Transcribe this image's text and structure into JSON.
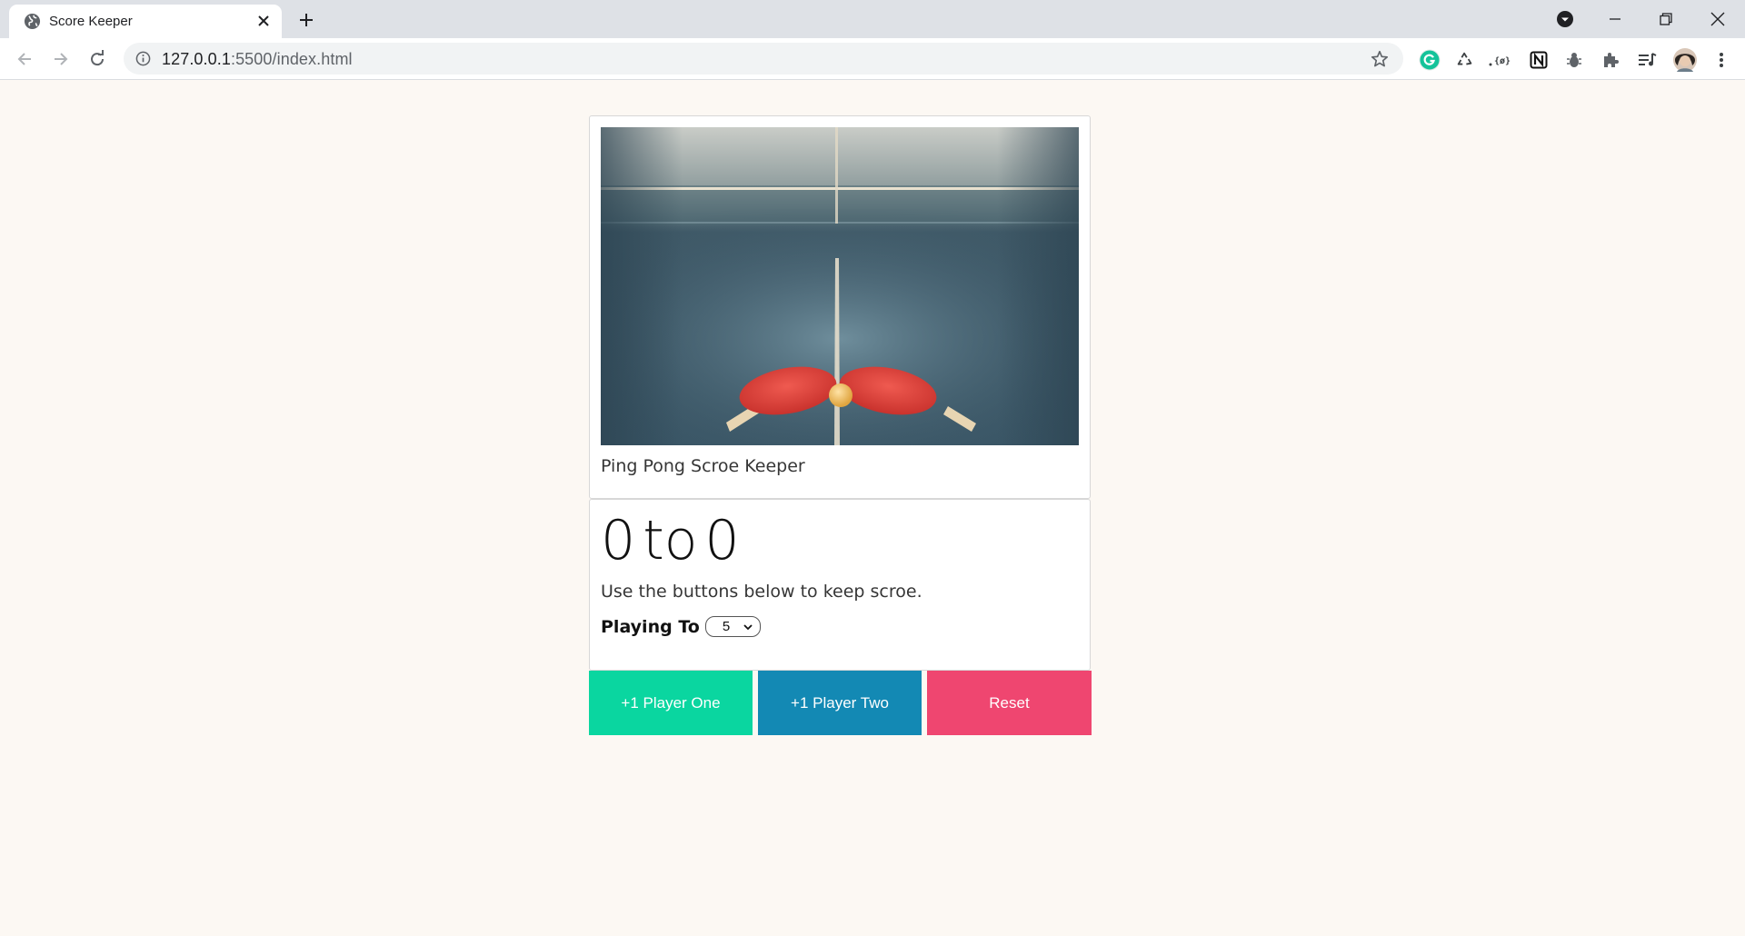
{
  "browser": {
    "tab_title": "Score Keeper",
    "url_host": "127.0.0.1",
    "url_path": ":5500/index.html"
  },
  "card": {
    "caption": "Ping Pong Scroe Keeper"
  },
  "score": {
    "player_one": "0",
    "separator": "to",
    "player_two": "0",
    "hint": "Use the buttons below to keep scroe.",
    "playing_to_label": "Playing To",
    "playing_to_value": "5"
  },
  "buttons": {
    "player_one": "+1 Player One",
    "player_two": "+1 Player Two",
    "reset": "Reset"
  },
  "colors": {
    "player_one": "#0ad6a0",
    "player_two": "#1389b4",
    "reset": "#ef4670",
    "page_bg": "#fcf8f3"
  }
}
